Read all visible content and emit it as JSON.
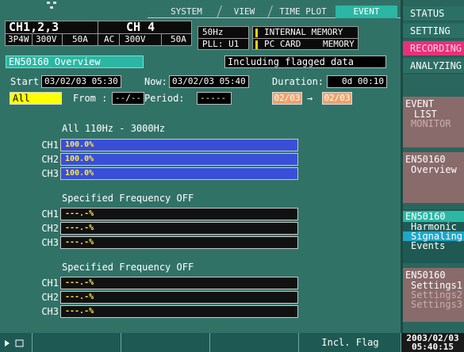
{
  "colors": {
    "accent_teal": "#2bb7a4",
    "recording_pink": "#e8307a",
    "bar_blue": "#3a4fd8",
    "date_orange": "#f0a26a",
    "all_yellow": "#ffff00"
  },
  "tabs": [
    "SYSTEM",
    "VIEW",
    "TIME PLOT",
    "EVENT"
  ],
  "wiring": {
    "ch_group": "CH1,2,3",
    "ch4": "CH 4",
    "conn": "3P4W",
    "v1": "300V",
    "a1": "50A",
    "ac": "AC",
    "v4": "300V",
    "a4": "50A"
  },
  "freq": {
    "hz": "50Hz",
    "pll": "PLL: U1"
  },
  "memory": {
    "internal": "INTERNAL MEMORY",
    "card_pc": "PC CARD",
    "card_mem": "MEMORY"
  },
  "info": {
    "overview": "EN50160 Overview",
    "flagged": "Including flagged data",
    "start_label": "Start:",
    "start": "03/02/03 05:30",
    "now_label": "Now:",
    "now": "03/02/03 05:40",
    "duration_label": "Duration:",
    "duration": "0d 00:10",
    "filter": "All",
    "from_label": "From :",
    "from": "--/--",
    "period_label": "Period:",
    "period": "-----",
    "date_from": "02/03",
    "arrow": "→",
    "date_to": "02/03"
  },
  "sections": [
    {
      "title": "All  110Hz - 3000Hz",
      "rows": [
        {
          "ch": "CH1",
          "text": "100.0%",
          "pct": 100
        },
        {
          "ch": "CH2",
          "text": "100.0%",
          "pct": 100
        },
        {
          "ch": "CH3",
          "text": "100.0%",
          "pct": 100
        }
      ]
    },
    {
      "title": "Specified Frequency OFF",
      "rows": [
        {
          "ch": "CH1",
          "text": "---.-%",
          "pct": 0
        },
        {
          "ch": "CH2",
          "text": "---.-%",
          "pct": 0
        },
        {
          "ch": "CH3",
          "text": "---.-%",
          "pct": 0
        }
      ]
    },
    {
      "title": "Specified Frequency OFF",
      "rows": [
        {
          "ch": "CH1",
          "text": "---.-%",
          "pct": 0
        },
        {
          "ch": "CH2",
          "text": "---.-%",
          "pct": 0
        },
        {
          "ch": "CH3",
          "text": "---.-%",
          "pct": 0
        }
      ]
    }
  ],
  "right": {
    "menu": [
      "STATUS",
      "SETTING",
      "RECORDING",
      "ANALYZING"
    ],
    "event": {
      "hd": "EVENT",
      "list": "LIST",
      "monitor": "MONITOR"
    },
    "overview": {
      "hd": "EN50160",
      "it": "Overview"
    },
    "harmonic": {
      "hd": "EN50160",
      "a": "Harmonic",
      "b": "Signaling",
      "c": "Events"
    },
    "settings": {
      "hd": "EN50160",
      "a": "Settings1",
      "b": "Settings2",
      "c": "Settings3"
    },
    "date": "2003/02/03",
    "time": "05:40:15"
  },
  "bottom": {
    "flag": "Incl. Flag"
  }
}
